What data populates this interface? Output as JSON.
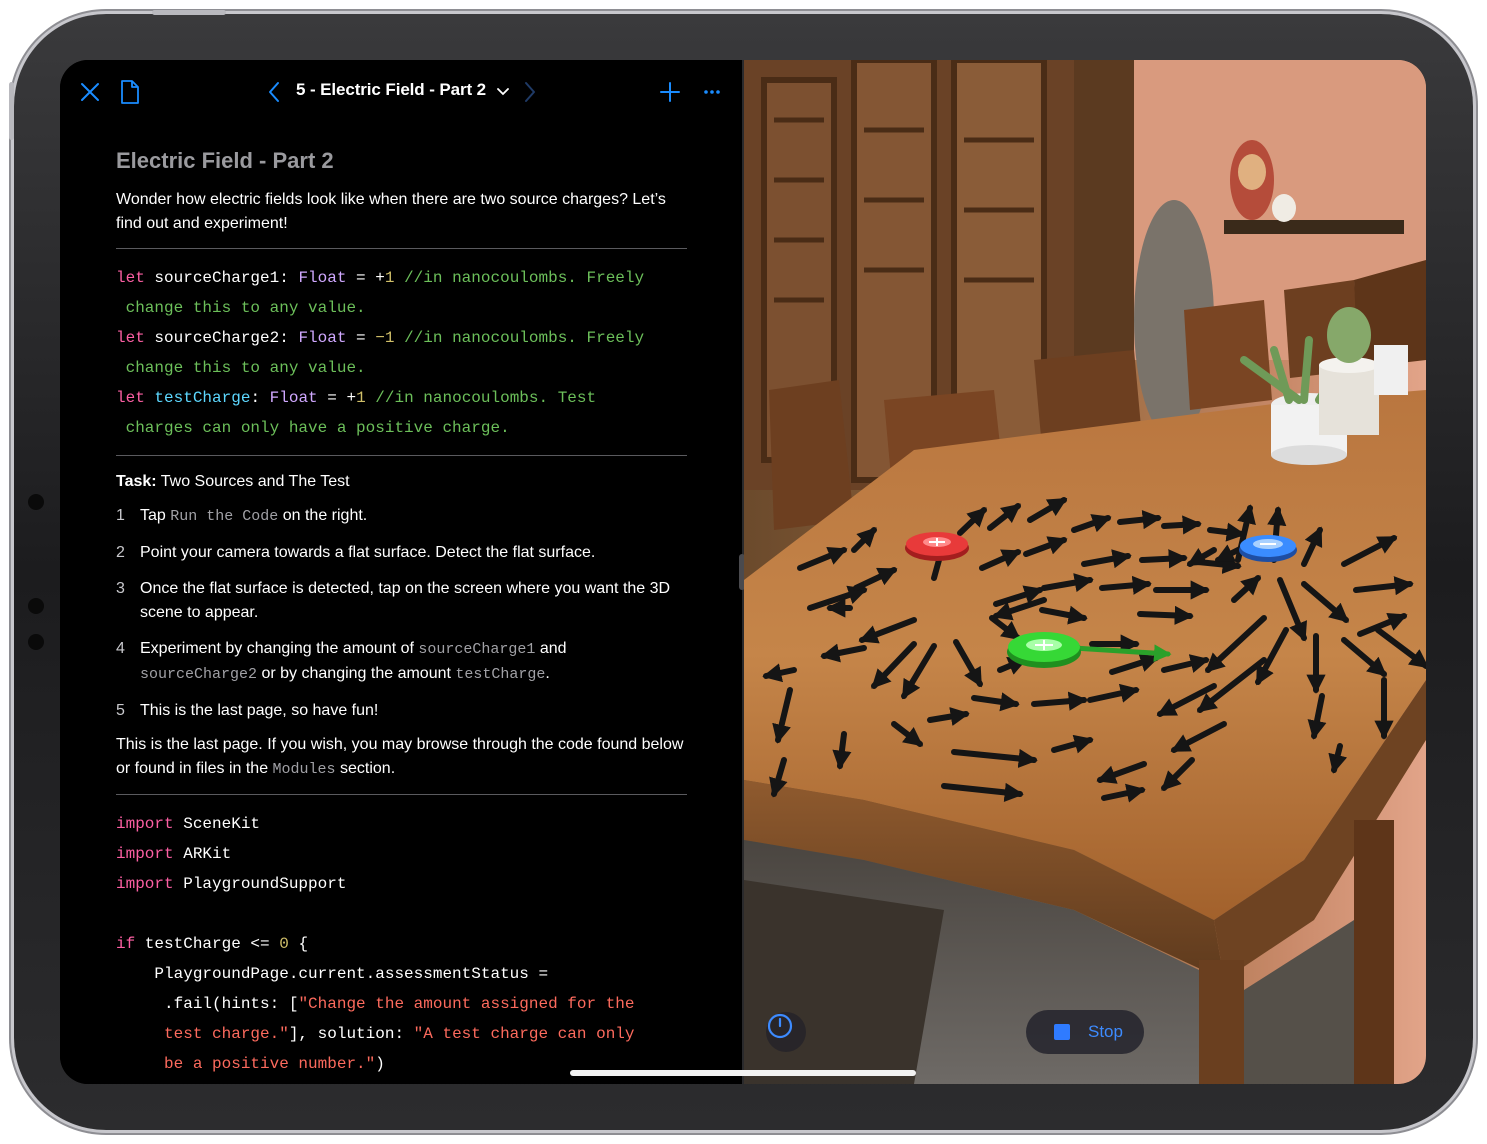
{
  "nav": {
    "title": "5 - Electric Field - Part 2",
    "close_icon": "close-icon",
    "document_icon": "document-icon",
    "add_icon": "plus-icon",
    "more_icon": "ellipsis-icon"
  },
  "page": {
    "heading": "Electric Field - Part 2",
    "intro": "Wonder how electric fields look like when there are two source charges? Let’s find out and experiment!",
    "task_label": "Task:",
    "task_title": "Two Sources and The Test",
    "steps": [
      {
        "num": "1",
        "pre": "Tap ",
        "code": "Run the Code",
        "post": " on the right."
      },
      {
        "num": "2",
        "text": "Point your camera towards a flat surface. Detect the flat surface."
      },
      {
        "num": "3",
        "text": "Once the flat surface is detected, tap on the screen where you want the 3D scene to appear."
      },
      {
        "num": "4",
        "pre": "Experiment by changing the amount of ",
        "code1": "sourceCharge1",
        "mid1": " and ",
        "code2": "sourceCharge2",
        "mid2": " or by changing the amount ",
        "code3": "testCharge",
        "post": "."
      },
      {
        "num": "5",
        "text": "This is the last page, so have fun!"
      }
    ],
    "outro_pre": "This is the last page. If you wish, you may browse through the code found below or found in files in the ",
    "outro_code": "Modules",
    "outro_post": " section."
  },
  "code_top": {
    "l1_kw": "let",
    "l1_name": " sourceCharge1:",
    "l1_type": " Float",
    "l1_eq": " = +",
    "l1_val": "1",
    "l1_cm": " //in nanocoulombs. Freely",
    "l1_cm2": " change this to any value.",
    "l2_kw": "let",
    "l2_name": " sourceCharge2:",
    "l2_type": " Float",
    "l2_eq": " = ",
    "l2_val": "−1",
    "l2_cm": " //in nanocoulombs. Freely",
    "l2_cm2": " change this to any value.",
    "l3_kw": "let",
    "l3_name": " testCharge",
    "l3_colon": ":",
    "l3_type": " Float",
    "l3_eq": " = +",
    "l3_val": "1",
    "l3_cm": " //in nanocoulombs. Test",
    "l3_cm2": " charges can only have a positive charge."
  },
  "code_bottom": {
    "imp": "import",
    "m1": " SceneKit",
    "m2": " ARKit",
    "m3": " PlaygroundSupport",
    "if_kw": "if",
    "cond": " testCharge <= ",
    "zero": "0",
    "brace": " {",
    "l_assign": "    PlaygroundPage.current.assessmentStatus =",
    "l_fail": "     .fail(hints: [",
    "s1": "\"Change the amount assigned for the",
    "s1b": "     test charge.\"",
    "l_sol": "], solution: ",
    "s2": "\"A test charge can only",
    "s2b": "     be a positive number.\"",
    "close": ")"
  },
  "ar": {
    "stop_label": "Stop",
    "stop_icon": "stop-icon",
    "speed_icon": "speedometer-icon"
  },
  "colors": {
    "accent": "#1a8cff",
    "positive_charge": "#e83a3a",
    "negative_charge": "#3a8cff",
    "test_charge": "#36d836",
    "keyword": "#fc5fa3",
    "comment": "#6cbf5a",
    "string": "#fc6a5d"
  }
}
